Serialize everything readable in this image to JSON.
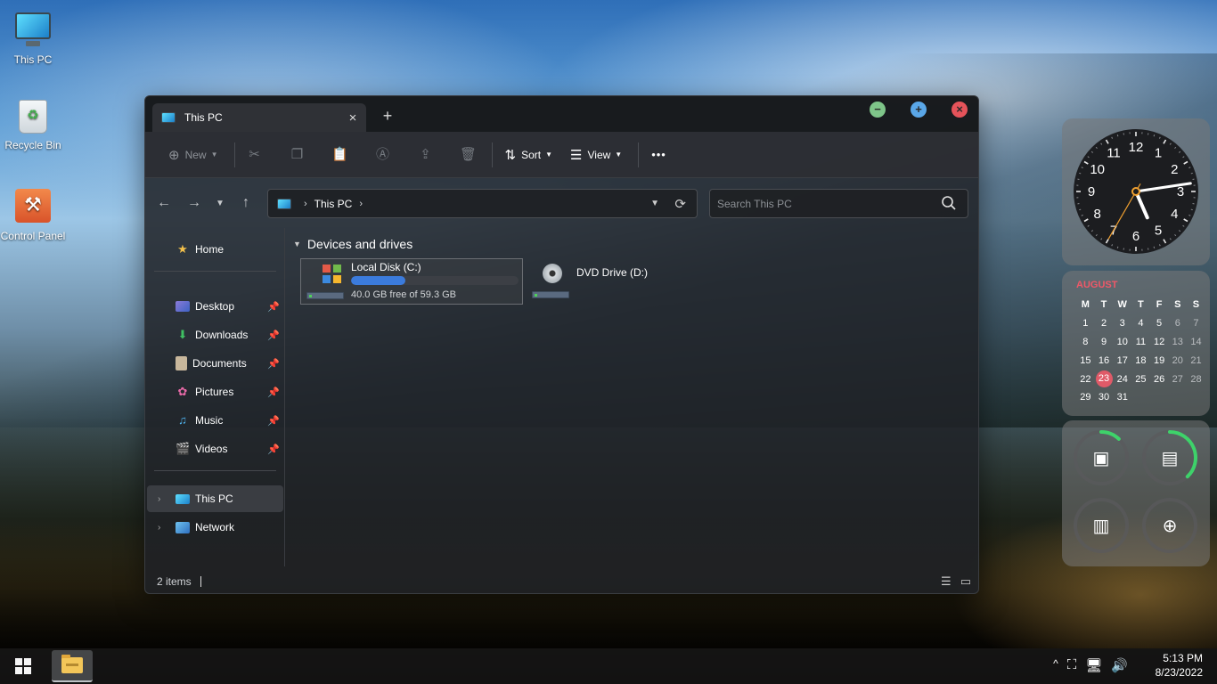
{
  "desktop": {
    "icons": [
      {
        "label": "This PC"
      },
      {
        "label": "Recycle Bin"
      },
      {
        "label": "Control Panel"
      }
    ]
  },
  "window": {
    "tab_title": "This PC",
    "close_tab": "×",
    "new_tab": "+",
    "controls": {
      "minimize": "−",
      "maximize": "+",
      "close": "×"
    },
    "toolbar": {
      "new_label": "New",
      "sort_label": "Sort",
      "view_label": "View",
      "more_label": "•••"
    },
    "address": {
      "crumb_sep": "›",
      "crumb": "This PC",
      "crumb_end": "›"
    },
    "search": {
      "placeholder": "Search This PC"
    },
    "sidebar": {
      "home": "Home",
      "pinned": [
        {
          "label": "Desktop"
        },
        {
          "label": "Downloads"
        },
        {
          "label": "Documents"
        },
        {
          "label": "Pictures"
        },
        {
          "label": "Music"
        },
        {
          "label": "Videos"
        }
      ],
      "this_pc": "This PC",
      "network": "Network"
    },
    "content": {
      "group": "Devices and drives",
      "drives": [
        {
          "name": "Local Disk (C:)",
          "free": "40.0 GB free of 59.3 GB",
          "used_fraction": 0.325
        },
        {
          "name": "DVD Drive (D:)"
        }
      ]
    },
    "status": {
      "items": "2 items"
    }
  },
  "widgets": {
    "clock": {
      "numbers": [
        "12",
        "1",
        "2",
        "3",
        "4",
        "5",
        "6",
        "7",
        "8",
        "9",
        "10",
        "11"
      ],
      "time": {
        "h": 5,
        "m": 13,
        "s": 35
      }
    },
    "calendar": {
      "month": "AUGUST",
      "weekdays": [
        "M",
        "T",
        "W",
        "T",
        "F",
        "S",
        "S"
      ],
      "weeks": [
        [
          "1",
          "2",
          "3",
          "4",
          "5",
          "6",
          "7"
        ],
        [
          "8",
          "9",
          "10",
          "11",
          "12",
          "13",
          "14"
        ],
        [
          "15",
          "16",
          "17",
          "18",
          "19",
          "20",
          "21"
        ],
        [
          "22",
          "23",
          "24",
          "25",
          "26",
          "27",
          "28"
        ],
        [
          "29",
          "30",
          "31",
          "",
          "",
          "",
          ""
        ]
      ],
      "today": "23"
    },
    "system": {
      "cpu_fraction": 0.12,
      "ram_fraction": 0.38,
      "disk_fraction": 0.0,
      "net_fraction": 0.0,
      "accent": "#3ed26a"
    }
  },
  "taskbar": {
    "tray": {
      "chevron": "^"
    },
    "time": "5:13 PM",
    "date": "8/23/2022"
  }
}
